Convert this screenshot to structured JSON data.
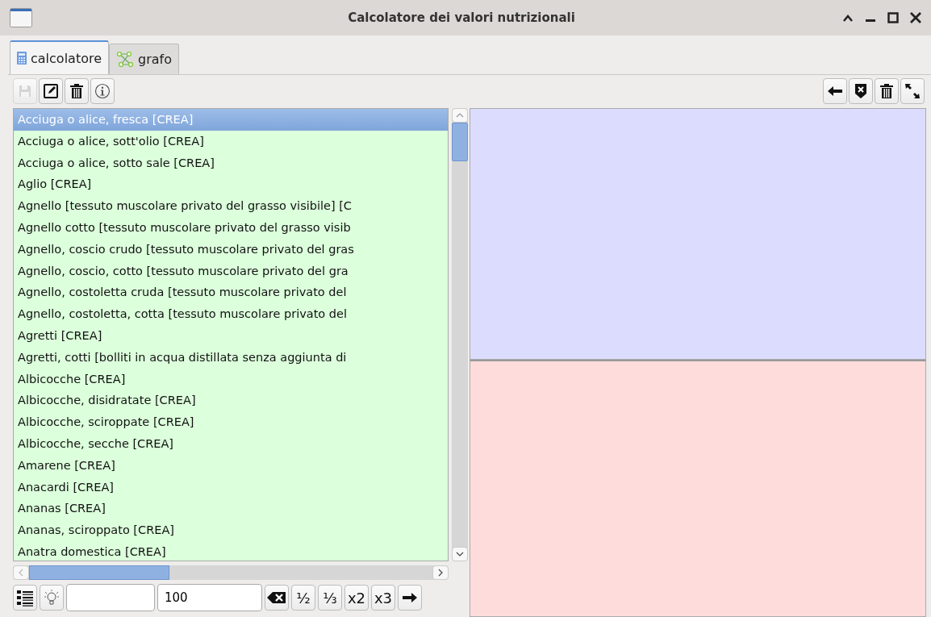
{
  "window": {
    "title": "Calcolatore dei valori nutrizionali"
  },
  "tabs": [
    {
      "label": "calcolatore",
      "selected": true,
      "kind": "calculator"
    },
    {
      "label": "grafo",
      "selected": false,
      "kind": "graph"
    }
  ],
  "toolbar_left": [
    {
      "kind": "save",
      "disabled": true
    },
    {
      "kind": "edit",
      "disabled": false
    },
    {
      "kind": "trash",
      "disabled": false
    },
    {
      "kind": "info",
      "disabled": false
    }
  ],
  "toolbar_right": [
    {
      "kind": "arrow-left",
      "disabled": false
    },
    {
      "kind": "shield-x",
      "disabled": false
    },
    {
      "kind": "trash",
      "disabled": false
    },
    {
      "kind": "expand",
      "disabled": false
    }
  ],
  "food_list": [
    {
      "label": "Acciuga o alice, fresca [CREA]",
      "selected": true
    },
    {
      "label": "Acciuga o alice, sott'olio [CREA]",
      "selected": false
    },
    {
      "label": "Acciuga o alice, sotto sale [CREA]",
      "selected": false
    },
    {
      "label": "Aglio [CREA]",
      "selected": false
    },
    {
      "label": "Agnello [tessuto muscolare privato del grasso visibile] [C",
      "selected": false
    },
    {
      "label": "Agnello cotto [tessuto muscolare privato del grasso visib",
      "selected": false
    },
    {
      "label": "Agnello, coscio crudo [tessuto muscolare privato del gras",
      "selected": false
    },
    {
      "label": "Agnello, coscio, cotto [tessuto muscolare privato del gra",
      "selected": false
    },
    {
      "label": "Agnello, costoletta cruda [tessuto muscolare privato del",
      "selected": false
    },
    {
      "label": "Agnello, costoletta, cotta [tessuto muscolare privato del",
      "selected": false
    },
    {
      "label": "Agretti [CREA]",
      "selected": false
    },
    {
      "label": "Agretti, cotti [bolliti in acqua distillata senza aggiunta di",
      "selected": false
    },
    {
      "label": "Albicocche [CREA]",
      "selected": false
    },
    {
      "label": "Albicocche, disidratate [CREA]",
      "selected": false
    },
    {
      "label": "Albicocche, sciroppate [CREA]",
      "selected": false
    },
    {
      "label": "Albicocche, secche [CREA]",
      "selected": false
    },
    {
      "label": "Amarene [CREA]",
      "selected": false
    },
    {
      "label": "Anacardi [CREA]",
      "selected": false
    },
    {
      "label": "Ananas [CREA]",
      "selected": false
    },
    {
      "label": "Ananas, sciroppato [CREA]",
      "selected": false
    },
    {
      "label": "Anatra domestica [CREA]",
      "selected": false
    }
  ],
  "bottom_bar": {
    "quantity": {
      "value": "100"
    },
    "buttons": [
      {
        "kind": "backspace"
      },
      {
        "kind": "text",
        "label": "½"
      },
      {
        "kind": "text",
        "label": "⅓"
      },
      {
        "kind": "text",
        "label": "x2"
      },
      {
        "kind": "text",
        "label": "x3"
      },
      {
        "kind": "arrow-right"
      }
    ]
  }
}
